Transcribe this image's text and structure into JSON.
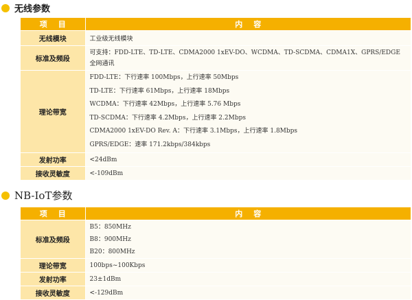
{
  "wireless": {
    "title": "无线参数",
    "header": {
      "item": "项目",
      "content": "内容"
    },
    "rows": [
      {
        "label": "无线模块",
        "lines": [
          "工业级无线模块"
        ]
      },
      {
        "label": "标准及频段",
        "lines": [
          "可支持：FDD-LTE、TD-LTE、CDMA2000 1xEV-DO、WCDMA、TD-SCDMA、CDMA1X、GPRS/EDGE",
          "全网通讯"
        ]
      },
      {
        "label": "理论带宽",
        "lines": [
          "FDD-LTE：下行速率 100Mbps，上行速率 50Mbps",
          "TD-LTE：下行速率 61Mbps，上行速率 18Mbps",
          "WCDMA：下行速率 42Mbps，上行速率 5.76 Mbps",
          "TD-SCDMA：下行速率 4.2Mbps，上行速率 2.2Mbps",
          "CDMA2000 1xEV-DO Rev. A：下行速率 3.1Mbps，上行速率 1.8Mbps",
          "GPRS/EDGE：速率 171.2kbps/384kbps"
        ]
      },
      {
        "label": "发射功率",
        "lines": [
          "<24dBm"
        ]
      },
      {
        "label": "接收灵敏度",
        "lines": [
          "<-109dBm"
        ]
      }
    ]
  },
  "nbiot": {
    "title": "NB-IoT参数",
    "header": {
      "item": "项目",
      "content": "内容"
    },
    "rows": [
      {
        "label": "标准及频段",
        "lines": [
          "B5：850MHz",
          "B8：900MHz",
          "B20：800MHz"
        ]
      },
      {
        "label": "理论带宽",
        "lines": [
          "100bps~100Kbps"
        ]
      },
      {
        "label": "发射功率",
        "lines": [
          "23±1dBm"
        ]
      },
      {
        "label": "接收灵敏度",
        "lines": [
          "<-129dBm"
        ]
      }
    ]
  },
  "colors": {
    "accent": "#f5b000",
    "label_bg": "#fde6a8",
    "value_bg": "#fdfbf3",
    "bullet": "#f5c000"
  }
}
